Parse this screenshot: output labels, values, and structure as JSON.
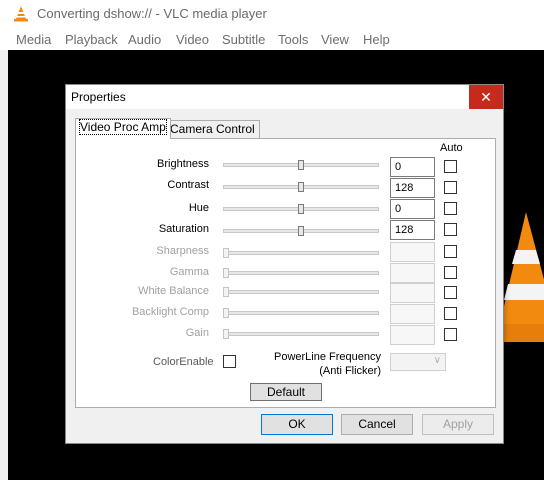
{
  "window": {
    "title": "Converting dshow:// - VLC media player",
    "icon": "vlc-cone-icon"
  },
  "menubar": {
    "items": [
      "Media",
      "Playback",
      "Audio",
      "Video",
      "Subtitle",
      "Tools",
      "View",
      "Help"
    ]
  },
  "dialog": {
    "title": "Properties",
    "close_label": "✕",
    "tabs": [
      "Video Proc Amp",
      "Camera Control"
    ],
    "auto_label": "Auto",
    "properties": [
      {
        "label": "Brightness",
        "value": "0",
        "enabled": true,
        "level": 0.5
      },
      {
        "label": "Contrast",
        "value": "128",
        "enabled": true,
        "level": 0.5
      },
      {
        "label": "Hue",
        "value": "0",
        "enabled": true,
        "level": 0.5
      },
      {
        "label": "Saturation",
        "value": "128",
        "enabled": true,
        "level": 0.5
      },
      {
        "label": "Sharpness",
        "value": "",
        "enabled": false,
        "level": 0
      },
      {
        "label": "Gamma",
        "value": "",
        "enabled": false,
        "level": 0
      },
      {
        "label": "White Balance",
        "value": "",
        "enabled": false,
        "level": 0
      },
      {
        "label": "Backlight Comp",
        "value": "",
        "enabled": false,
        "level": 0
      },
      {
        "label": "Gain",
        "value": "",
        "enabled": false,
        "level": 0
      }
    ],
    "color_enable_label": "ColorEnable",
    "powerline_label_1": "PowerLine Frequency",
    "powerline_label_2": "(Anti Flicker)",
    "powerline_value": "",
    "default_button": "Default",
    "ok_button": "OK",
    "cancel_button": "Cancel",
    "apply_button": "Apply"
  },
  "colors": {
    "close_button": "#c42b1c",
    "vlc_orange": "#f28a10",
    "video_background": "#000000",
    "dialog_background": "#f0f0f0"
  }
}
